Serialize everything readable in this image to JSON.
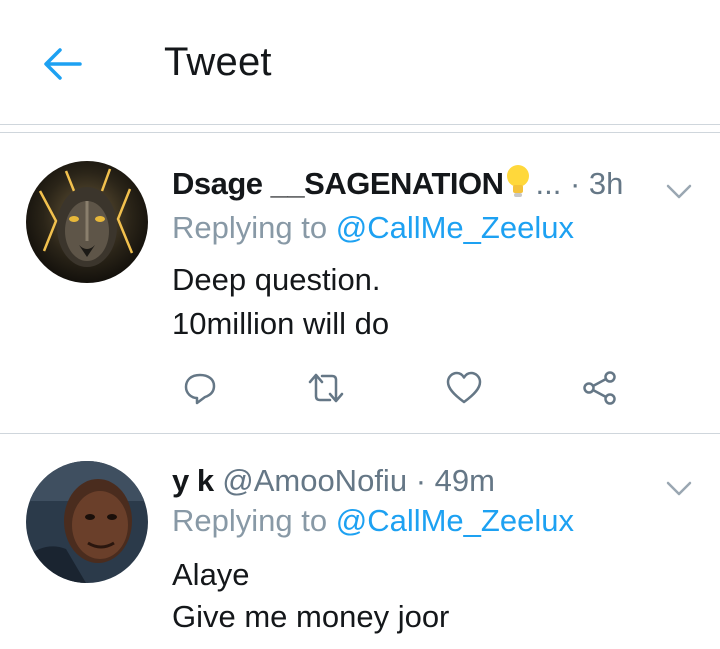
{
  "header": {
    "title": "Tweet",
    "back_icon": "arrow-left-icon",
    "accent_color": "#1da1f2"
  },
  "tweets": [
    {
      "display_name": "Dsage __SAGENATION",
      "name_emoji": "lightbulb-icon",
      "truncation": "...",
      "time": "· 3h",
      "replying_prefix": "Replying to ",
      "replying_to": "@CallMe_Zeelux",
      "text_lines": [
        "Deep question.",
        "10million will do"
      ],
      "actions": [
        "reply-icon",
        "retweet-icon",
        "like-icon",
        "share-icon"
      ]
    },
    {
      "display_name": "y k",
      "handle": "@AmooNofiu",
      "time": "· 49m",
      "replying_prefix": "Replying to ",
      "replying_to": "@CallMe_Zeelux",
      "text_lines": [
        "Alaye",
        "Give me money joor"
      ]
    }
  ],
  "colors": {
    "text": "#14171a",
    "secondary": "#657786",
    "link": "#1da1f2",
    "divider": "#cfd6dc"
  }
}
